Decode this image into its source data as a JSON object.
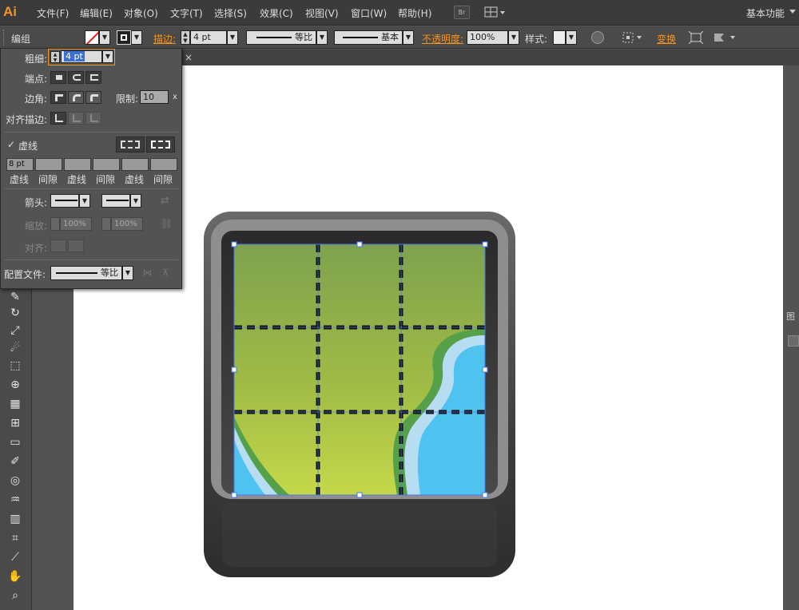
{
  "app": {
    "logo": "Ai",
    "workspace": "基本功能"
  },
  "menu": [
    "文件(F)",
    "编辑(E)",
    "对象(O)",
    "文字(T)",
    "选择(S)",
    "效果(C)",
    "视图(V)",
    "窗口(W)",
    "帮助(H)"
  ],
  "menu_extra": {
    "bridge": "Br"
  },
  "control": {
    "group_label": "编组",
    "stroke_label": "描边:",
    "stroke_weight": "4 pt",
    "profile1": "等比",
    "profile2": "基本",
    "opacity_label": "不透明度:",
    "opacity_value": "100%",
    "style_label": "样式:",
    "transform_label": "变换"
  },
  "stroke_panel": {
    "weight_label": "粗细:",
    "weight_value": "4 pt",
    "cap_label": "端点:",
    "corner_label": "边角:",
    "limit_label": "限制:",
    "limit_value": "10",
    "limit_unit": "x",
    "align_label": "对齐描边:",
    "dashed_label": "虚线",
    "dashed_checked": true,
    "dash_values": [
      "8 pt",
      "",
      "",
      "",
      "",
      ""
    ],
    "dash_labels": [
      "虚线",
      "间隙",
      "虚线",
      "间隙",
      "虚线",
      "间隙"
    ],
    "arrow_label": "箭头:",
    "scale_label": "缩放:",
    "scale_1": "100%",
    "scale_2": "100%",
    "align2_label": "对齐:",
    "profile_label": "配置文件:",
    "profile_value": "等比"
  },
  "tab": {
    "close": "×"
  },
  "right_panel": {
    "label": "图"
  },
  "colors": {
    "accent": "#f7941e",
    "map_green": "#8aaa4e",
    "water": "#4fc3f0",
    "frame": "#3e3c3e"
  }
}
